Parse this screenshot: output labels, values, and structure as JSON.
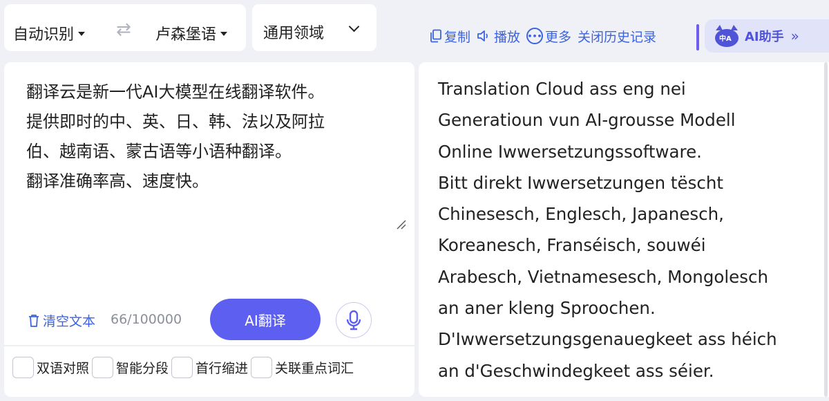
{
  "lang_bar": {
    "source_lang": "自动识别",
    "target_lang": "卢森堡语",
    "domain": "通用领域"
  },
  "toolbar": {
    "copy": "复制",
    "play": "播放",
    "more": "更多",
    "history": "关闭历史记录",
    "ai_helper": "AI助手",
    "ai_logo_text": "中A"
  },
  "source": {
    "lines": [
      "翻译云是新一代AI大模型在线翻译软件。",
      "提供即时的中、英、日、韩、法以及阿拉",
      "伯、越南语、蒙古语等小语种翻译。",
      "翻译准确率高、速度快。"
    ],
    "clear_label": "清空文本",
    "char_count": "66/100000",
    "translate_label": "AI翻译"
  },
  "options": [
    {
      "label": "双语对照",
      "checked": false
    },
    {
      "label": "智能分段",
      "checked": false
    },
    {
      "label": "首行缩进",
      "checked": false
    },
    {
      "label": "关联重点词汇",
      "checked": false
    }
  ],
  "target": {
    "lines": [
      "Translation Cloud ass eng nei",
      "Generatioun vun AI-grousse Modell",
      "Online Iwwersetzungssoftware.",
      "Bitt direkt Iwwersetzungen tëscht",
      "Chinesesch, Englesch, Japanesch,",
      "Koreanesch, Franséisch, souwéi",
      "Arabesch, Vietnamesesch, Mongolesch",
      "an aner kleng Sproochen.",
      "D'Iwwersetzungsgenauegkeet ass héich",
      "an d'Geschwindegkeet ass séier."
    ]
  },
  "colors": {
    "accent": "#5d5ff0",
    "link": "#3d63dd",
    "background": "#eff1f6"
  }
}
